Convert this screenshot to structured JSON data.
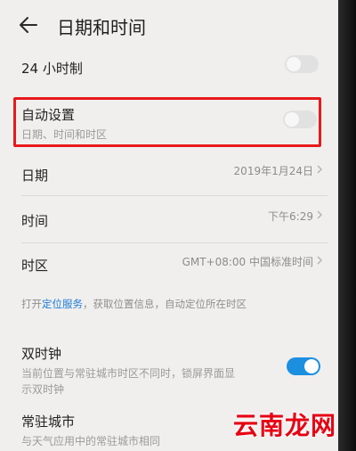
{
  "header": {
    "title": "日期和时间"
  },
  "settings": {
    "hour24": {
      "label": "24 小时制",
      "enabled": false
    },
    "auto": {
      "label": "自动设置",
      "sublabel": "日期、时间和时区",
      "enabled": false
    },
    "date": {
      "label": "日期",
      "value": "2019年1月24日"
    },
    "time": {
      "label": "时间",
      "value": "下午6:29"
    },
    "timezone": {
      "label": "时区",
      "value": "GMT+08:00 中国标准时间"
    }
  },
  "info": {
    "prefix": "打开",
    "link": "定位服务",
    "suffix": "，获取位置信息，自动定位所在时区"
  },
  "dual_clock": {
    "label": "双时钟",
    "desc_line1": "当前位置与常驻城市时区不同时，锁屏界面显",
    "desc_line2": "示双时钟",
    "enabled": true
  },
  "home_city": {
    "label": "常驻城市",
    "sublabel": "与天气应用中的常驻城市相同"
  },
  "watermark": {
    "text": "云南龙网"
  },
  "colors": {
    "accent": "#1c8fe0",
    "highlight": "#e8191b",
    "watermark": "#e60012"
  }
}
